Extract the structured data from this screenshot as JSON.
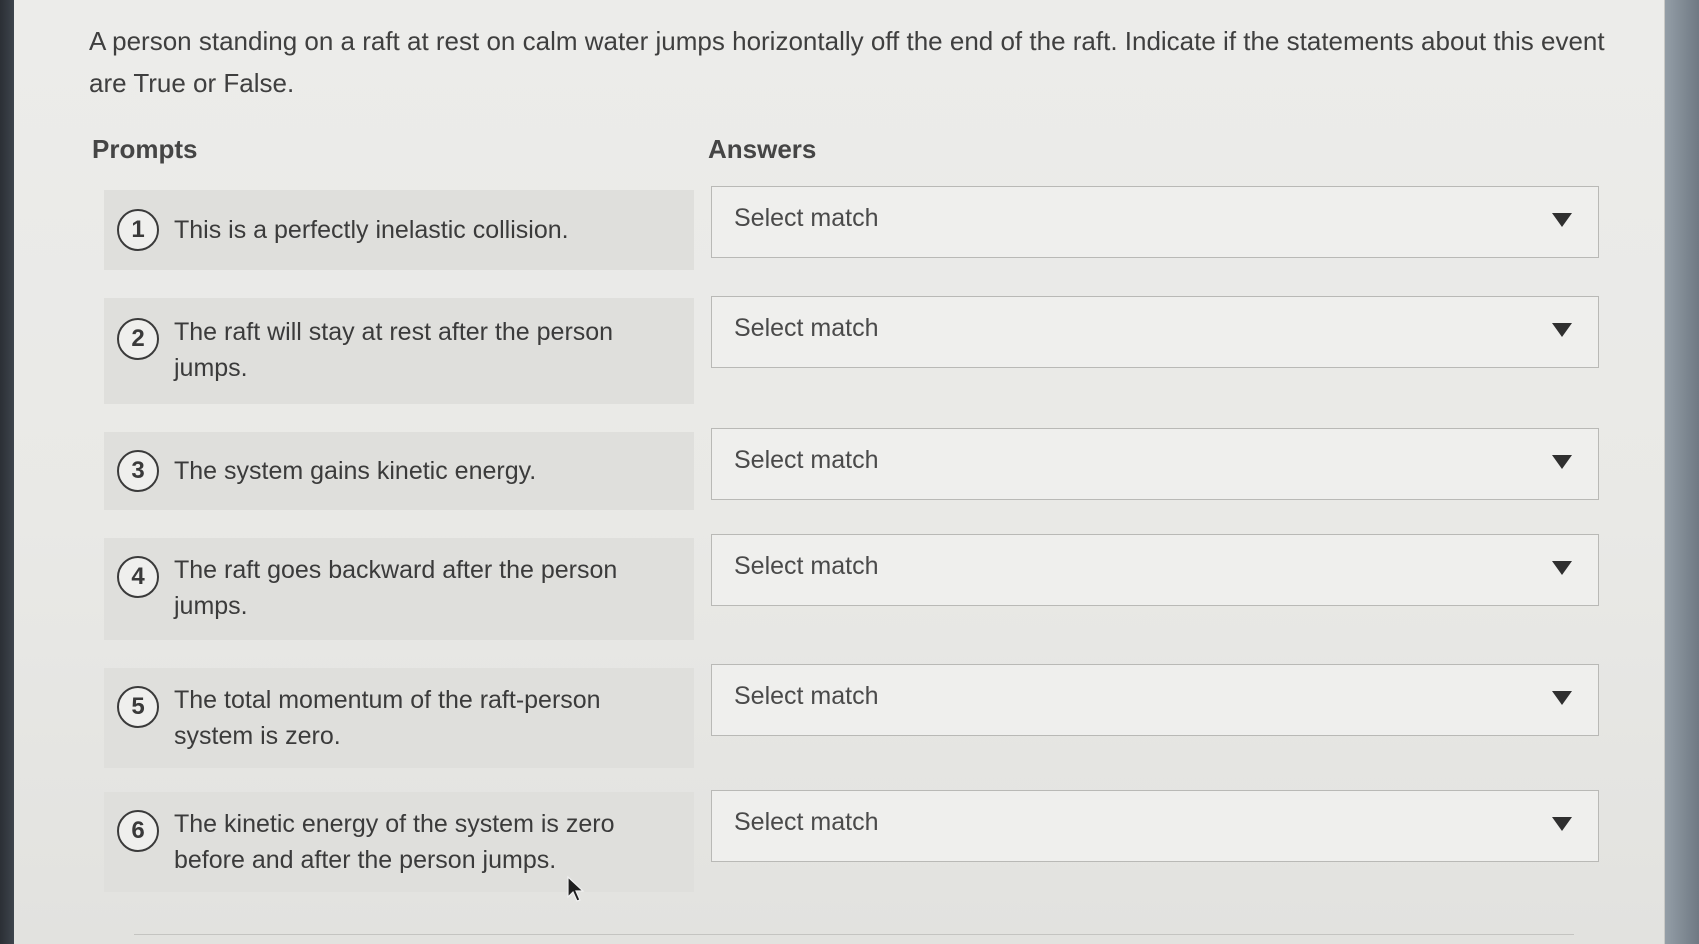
{
  "question": {
    "text": "A person standing on a raft at rest on calm water jumps horizontally off the end of the raft. Indicate if the statements about this event are True or False."
  },
  "columns": {
    "prompts_label": "Prompts",
    "answers_label": "Answers"
  },
  "items": [
    {
      "number": "1",
      "prompt": "This is a perfectly inelastic collision.",
      "answer": "Select match"
    },
    {
      "number": "2",
      "prompt": "The raft will stay at rest after the person jumps.",
      "answer": "Select match"
    },
    {
      "number": "3",
      "prompt": "The system gains kinetic energy.",
      "answer": "Select match"
    },
    {
      "number": "4",
      "prompt": "The raft goes backward after the person jumps.",
      "answer": "Select match"
    },
    {
      "number": "5",
      "prompt": "The total momentum of the raft-person system is zero.",
      "answer": "Select match"
    },
    {
      "number": "6",
      "prompt": "The kinetic energy of the system is zero before and after the person jumps.",
      "answer": "Select match"
    }
  ],
  "icons": {
    "dropdown": "chevron-down-icon",
    "cursor": "mouse-pointer-icon"
  }
}
